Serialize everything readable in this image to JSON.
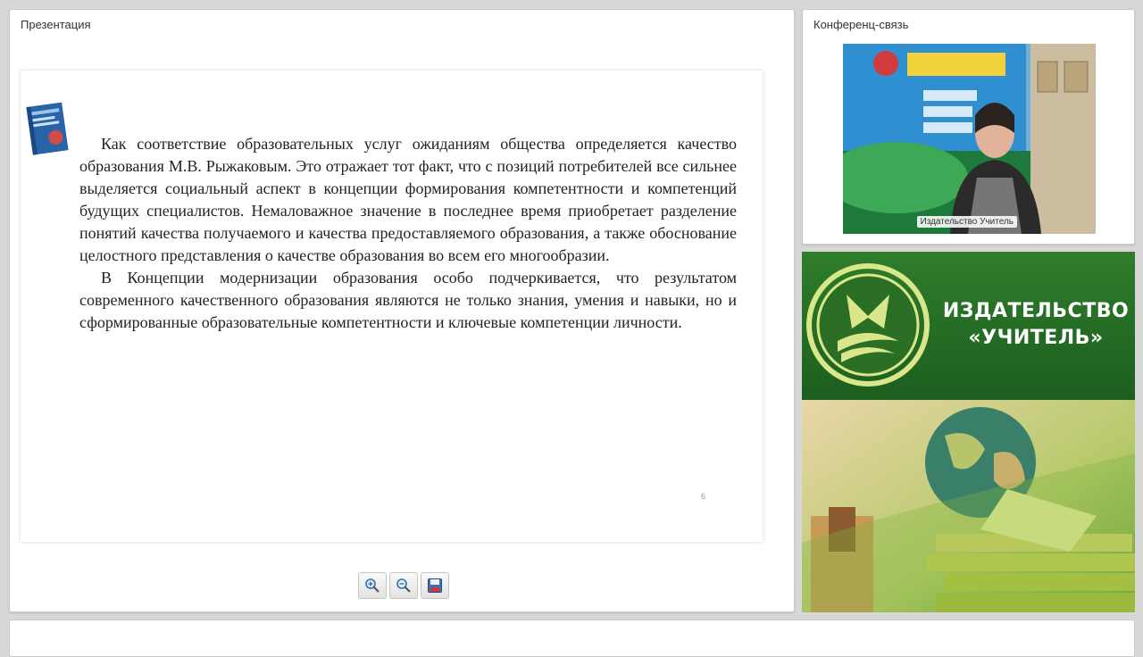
{
  "presentation": {
    "title": "Презентация",
    "slide": {
      "paragraphs": [
        "Как соответствие образовательных услуг ожиданиям общества определяется качество образования М.В. Рыжаковым. Это отражает тот факт, что с позиций потребителей все сильнее выделяется социальный аспект в концепции формирования компетентности и компетенций будущих специалистов. Немаловажное значение в последнее время приобретает разделение понятий качества получаемого и качества предоставляемого образования, а также обоснование целостного представления о качестве образования во всем его многообразии.",
        "В Концепции модернизации образования особо подчеркивается, что результатом современного качественного образования являются не только знания, умения и навыки, но и сформированные образовательные компетентности и ключевые компетенции личности."
      ],
      "page_number": "6"
    },
    "toolbar": {
      "zoom_in_icon": "zoom-in-icon",
      "zoom_out_icon": "zoom-out-icon",
      "save_icon": "floppy-disk-icon"
    }
  },
  "conference": {
    "title": "Конференц-связь",
    "video_label": "Издательство Учитель"
  },
  "publisher": {
    "name_line1": "ИЗДАТЕЛЬСТВО",
    "name_line2": "«УЧИТЕЛЬ»"
  },
  "colors": {
    "banner_green": "#2f7d2c",
    "logo_yellow": "#d9e78a"
  }
}
